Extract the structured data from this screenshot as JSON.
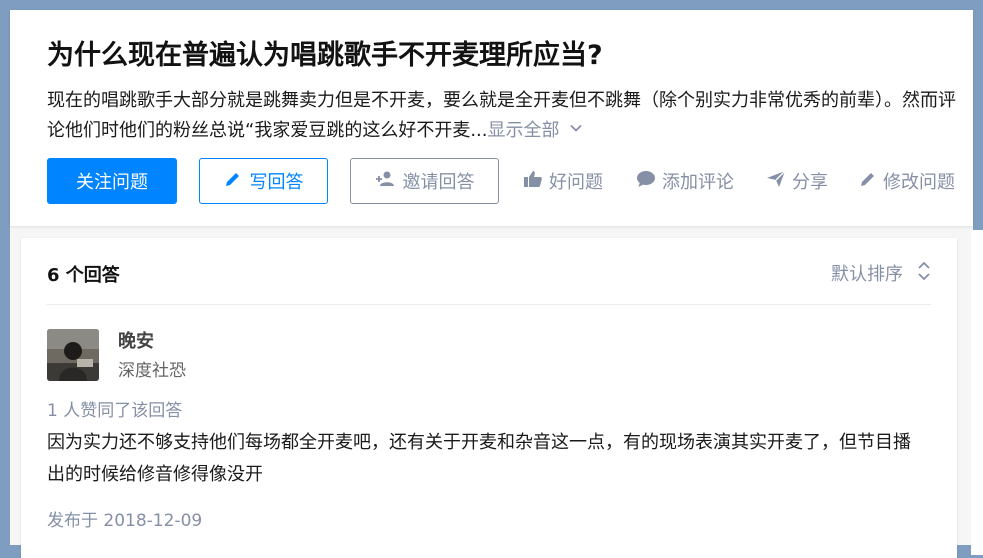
{
  "question": {
    "title": "为什么现在普遍认为唱跳歌手不开麦理所应当?",
    "description": "现在的唱跳歌手大部分就是跳舞卖力但是不开麦，要么就是全开麦但不跳舞（除个别实力非常优秀的前辈）。然而评论他们时他们的粉丝总说“我家爱豆跳的这么好不开麦...",
    "show_all_label": "显示全部",
    "follow_label": "关注问题",
    "write_label": "写回答",
    "invite_label": "邀请回答",
    "good_question_label": "好问题",
    "comment_label": "添加评论",
    "share_label": "分享",
    "edit_label": "修改问题"
  },
  "answers": {
    "count_label": "6 个回答",
    "sort_label": "默认排序",
    "items": [
      {
        "author_name": "晚安",
        "author_bio": "深度社恐",
        "votes_label": "1 人赞同了该回答",
        "content": "因为实力还不够支持他们每场都全开麦吧，还有关于开麦和杂音这一点，有的现场表演其实开麦了，但节目播出的时候给修音修得像没开",
        "publish_label": "发布于 2018-12-09"
      }
    ]
  },
  "colors": {
    "primary": "#0084ff",
    "muted": "#8590a6",
    "background": "#7f9dc0"
  }
}
